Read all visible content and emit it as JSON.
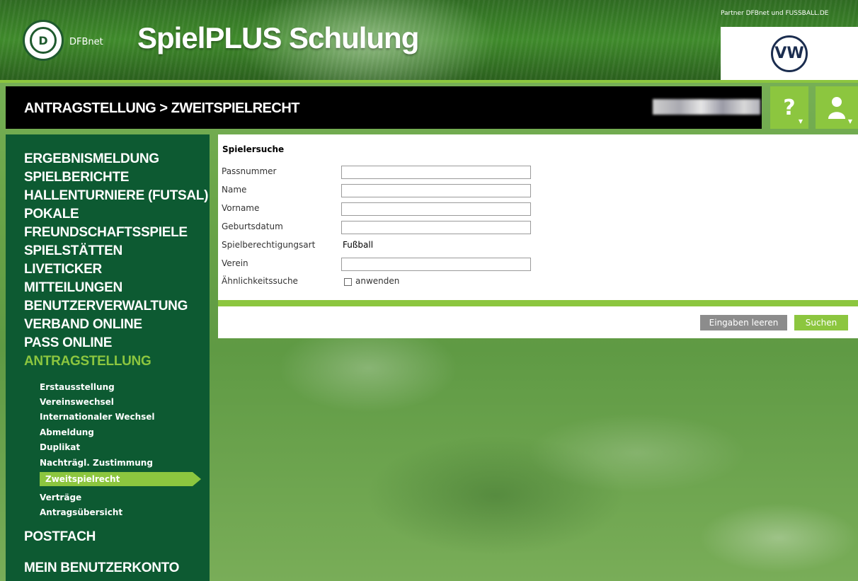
{
  "header": {
    "logo_text": "DFBnet",
    "app_title": "SpielPLUS Schulung",
    "partner_text": "Partner DFBnet und FUSSBALL.DE",
    "partner_logo": "VW"
  },
  "titlebar": {
    "breadcrumb": "ANTRAGSTELLUNG > ZWEITSPIELRECHT",
    "help_label": "?"
  },
  "sidebar": {
    "main_items": [
      {
        "label": "ERGEBNISMELDUNG"
      },
      {
        "label": "SPIELBERICHTE"
      },
      {
        "label": "HALLENTURNIERE (FUTSAL)"
      },
      {
        "label": "POKALE"
      },
      {
        "label": "FREUNDSCHAFTSSPIELE"
      },
      {
        "label": "SPIELSTÄTTEN"
      },
      {
        "label": "LIVETICKER"
      },
      {
        "label": "MITTEILUNGEN"
      },
      {
        "label": "BENUTZERVERWALTUNG"
      },
      {
        "label": "VERBAND ONLINE"
      },
      {
        "label": "PASS ONLINE"
      },
      {
        "label": "ANTRAGSTELLUNG"
      }
    ],
    "sub_items": [
      {
        "label": "Erstausstellung"
      },
      {
        "label": "Vereinswechsel"
      },
      {
        "label": "Internationaler Wechsel"
      },
      {
        "label": "Abmeldung"
      },
      {
        "label": "Duplikat"
      },
      {
        "label": "Nachträgl. Zustimmung"
      },
      {
        "label": "Zweitspielrecht"
      },
      {
        "label": "Verträge"
      },
      {
        "label": "Antragsübersicht"
      }
    ],
    "bottom_items": [
      {
        "label": "POSTFACH"
      },
      {
        "label": "MEIN BENUTZERKONTO"
      }
    ]
  },
  "form": {
    "title": "Spielersuche",
    "passnummer": {
      "label": "Passnummer",
      "value": ""
    },
    "name": {
      "label": "Name",
      "value": ""
    },
    "vorname": {
      "label": "Vorname",
      "value": ""
    },
    "geburtsdatum": {
      "label": "Geburtsdatum",
      "value": ""
    },
    "spielberechtigungsart": {
      "label": "Spielberechtigungsart",
      "value": "Fußball"
    },
    "verein": {
      "label": "Verein",
      "value": ""
    },
    "aehnlichkeitssuche": {
      "label": "Ähnlichkeitssuche",
      "checkbox_label": "anwenden",
      "checked": false
    }
  },
  "actions": {
    "clear_label": "Eingaben leeren",
    "search_label": "Suchen"
  },
  "colors": {
    "accent": "#8cc63f",
    "sidebar": "#0d5a32",
    "titlebar": "#000000"
  }
}
